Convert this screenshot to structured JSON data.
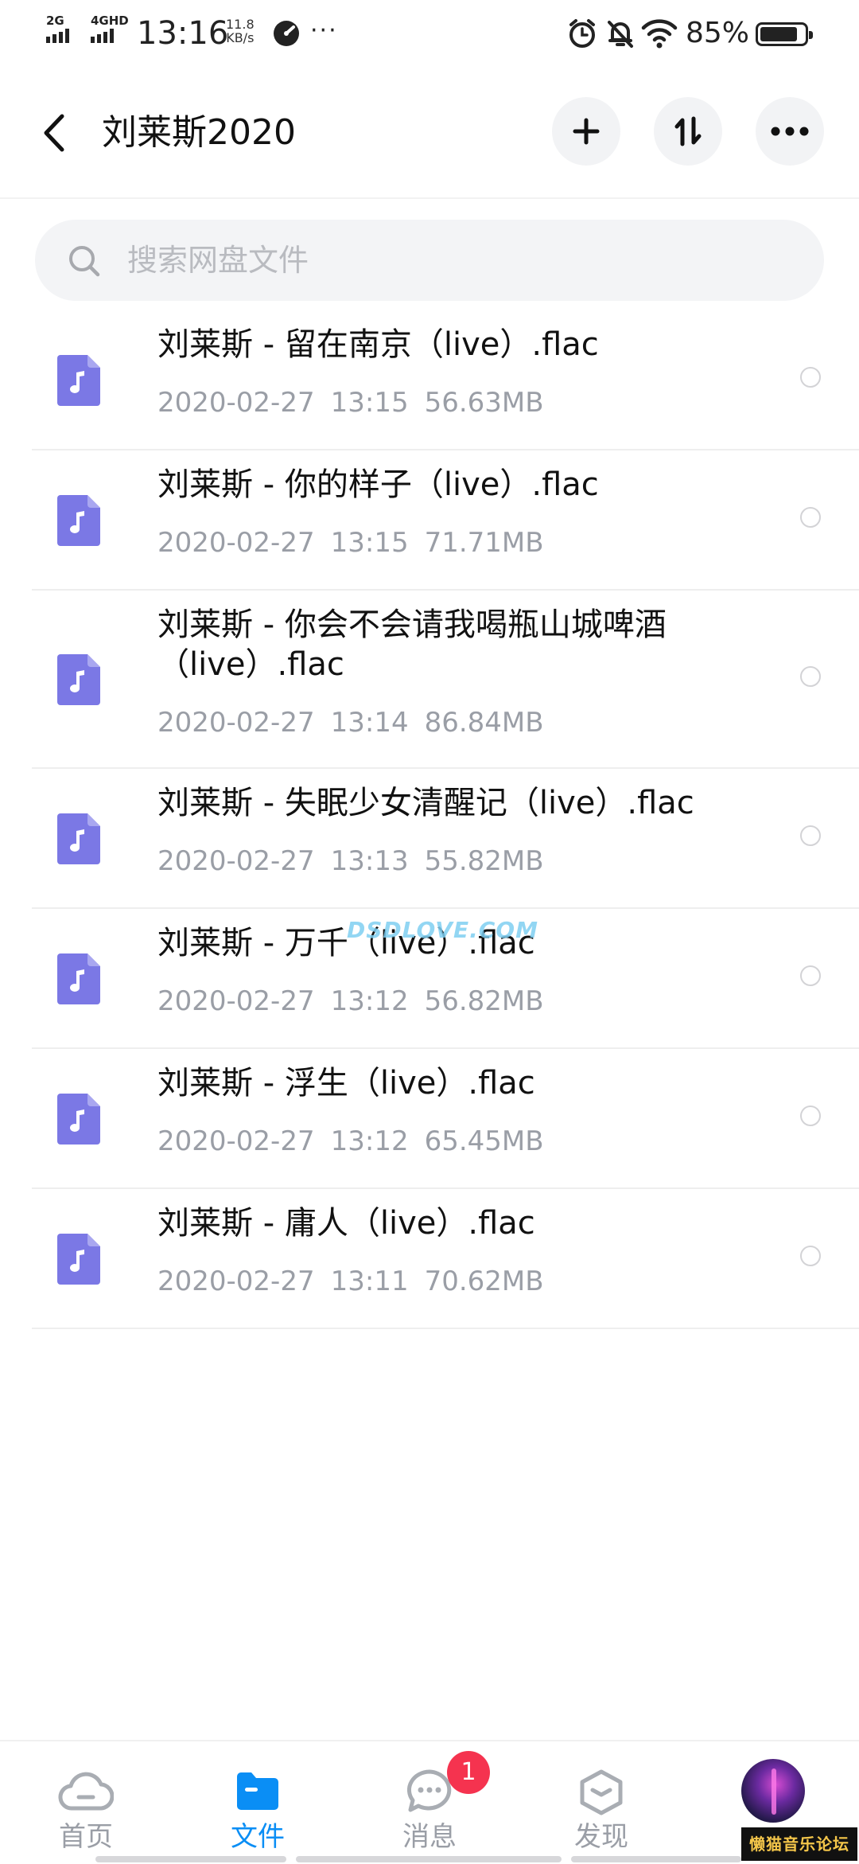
{
  "status_bar": {
    "signal_1": "2G",
    "signal_2": "4GHD",
    "time": "13:16",
    "speed_value": "11.8",
    "speed_unit": "KB/s",
    "more": "···",
    "battery_percent": "85%",
    "battery_level": 0.85
  },
  "header": {
    "title": "刘莱斯2020",
    "icons": {
      "back": "chevron-left-icon",
      "add": "plus-icon",
      "sort": "sort-arrows-icon",
      "more": "more-horizontal-icon"
    }
  },
  "search": {
    "placeholder": "搜索网盘文件",
    "value": ""
  },
  "files": [
    {
      "name": "刘莱斯 - 留在南京（live）.flac",
      "date": "2020-02-27",
      "time": "13:15",
      "size": "56.63MB"
    },
    {
      "name": "刘莱斯 - 你的样子（live）.flac",
      "date": "2020-02-27",
      "time": "13:15",
      "size": "71.71MB"
    },
    {
      "name": "刘莱斯 - 你会不会请我喝瓶山城啤酒（live）.flac",
      "date": "2020-02-27",
      "time": "13:14",
      "size": "86.84MB"
    },
    {
      "name": "刘莱斯 - 失眠少女清醒记（live）.flac",
      "date": "2020-02-27",
      "time": "13:13",
      "size": "55.82MB"
    },
    {
      "name": "刘莱斯 - 万千（live）.flac",
      "date": "2020-02-27",
      "time": "13:12",
      "size": "56.82MB"
    },
    {
      "name": "刘莱斯 - 浮生（live）.flac",
      "date": "2020-02-27",
      "time": "13:12",
      "size": "65.45MB"
    },
    {
      "name": "刘莱斯 - 庸人（live）.flac",
      "date": "2020-02-27",
      "time": "13:11",
      "size": "70.62MB"
    }
  ],
  "watermark": "DSDLOVE.COM",
  "nav": {
    "home": "首页",
    "files": "文件",
    "messages": "消息",
    "messages_badge": "1",
    "discover": "发现",
    "active": "files"
  },
  "forum_badge": "懒猫音乐论坛",
  "colors": {
    "accent": "#0a8ef5",
    "file_icon": "#7b78e5",
    "badge": "#f5334f",
    "meta_text": "#9a9ea6"
  }
}
